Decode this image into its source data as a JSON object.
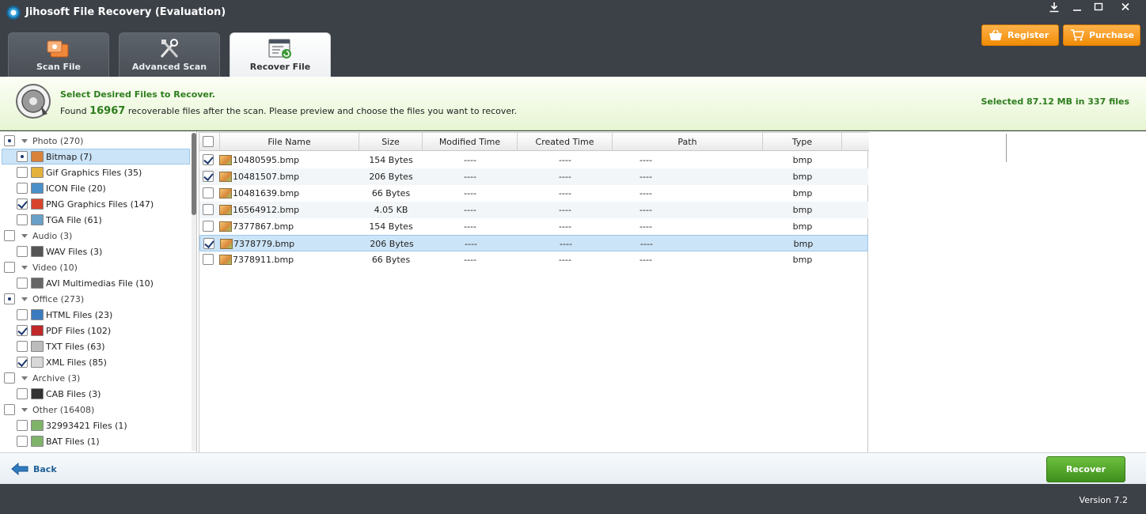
{
  "window": {
    "title": "Jihosoft File Recovery (Evaluation)",
    "controls": [
      "download",
      "minimize",
      "maximize",
      "close"
    ]
  },
  "tabs": [
    {
      "label": "Scan File",
      "icon": "scan-file-icon",
      "active": false
    },
    {
      "label": "Advanced Scan",
      "icon": "tools-icon",
      "active": false
    },
    {
      "label": "Recover File",
      "icon": "recover-file-icon",
      "active": true
    }
  ],
  "header_buttons": {
    "register": "Register",
    "purchase": "Purchase"
  },
  "banner": {
    "title": "Select Desired Files to Recover.",
    "found_prefix": "Found",
    "found_count": "16967",
    "found_suffix": "recoverable files after the scan. Please preview and choose the files you want to recover.",
    "selected": "Selected 87.12 MB in 337 files"
  },
  "tree": [
    {
      "label": "Photo (270)",
      "level": 0,
      "state": "partial"
    },
    {
      "label": "Bitmap (7)",
      "level": 1,
      "state": "partial",
      "selected": true,
      "icon_color": "#d9823a"
    },
    {
      "label": "Gif Graphics Files (35)",
      "level": 1,
      "state": "unchecked",
      "icon_color": "#e3b23c"
    },
    {
      "label": "ICON File (20)",
      "level": 1,
      "state": "unchecked",
      "icon_color": "#4a90c8"
    },
    {
      "label": "PNG Graphics Files (147)",
      "level": 1,
      "state": "checked",
      "icon_color": "#d8442b"
    },
    {
      "label": "TGA File (61)",
      "level": 1,
      "state": "unchecked",
      "icon_color": "#6aa0c8"
    },
    {
      "label": "Audio (3)",
      "level": 0,
      "state": "unchecked"
    },
    {
      "label": "WAV Files (3)",
      "level": 1,
      "state": "unchecked",
      "icon_color": "#555555"
    },
    {
      "label": "Video (10)",
      "level": 0,
      "state": "unchecked"
    },
    {
      "label": "AVI Multimedias File (10)",
      "level": 1,
      "state": "unchecked",
      "icon_color": "#666666"
    },
    {
      "label": "Office (273)",
      "level": 0,
      "state": "partial"
    },
    {
      "label": "HTML Files (23)",
      "level": 1,
      "state": "unchecked",
      "icon_color": "#3a7bbf"
    },
    {
      "label": "PDF Files (102)",
      "level": 1,
      "state": "checked",
      "icon_color": "#c0282a"
    },
    {
      "label": "TXT Files (63)",
      "level": 1,
      "state": "unchecked",
      "icon_color": "#bcbcbc"
    },
    {
      "label": "XML Files (85)",
      "level": 1,
      "state": "checked",
      "icon_color": "#d8d8d8"
    },
    {
      "label": "Archive (3)",
      "level": 0,
      "state": "unchecked"
    },
    {
      "label": "CAB Files (3)",
      "level": 1,
      "state": "unchecked",
      "icon_color": "#333333"
    },
    {
      "label": "Other (16408)",
      "level": 0,
      "state": "unchecked"
    },
    {
      "label": "32993421 Files (1)",
      "level": 1,
      "state": "unchecked",
      "icon_color": "#7fb36a"
    },
    {
      "label": "BAT Files (1)",
      "level": 1,
      "state": "unchecked",
      "icon_color": "#7fb36a"
    }
  ],
  "table": {
    "columns": [
      "File Name",
      "Size",
      "Modified Time",
      "Created Time",
      "Path",
      "Type"
    ],
    "rows": [
      {
        "name": "10480595.bmp",
        "size": "154 Bytes",
        "modified": "----",
        "created": "----",
        "path": "----",
        "type": "bmp",
        "checked": true,
        "selected": false
      },
      {
        "name": "10481507.bmp",
        "size": "206 Bytes",
        "modified": "----",
        "created": "----",
        "path": "----",
        "type": "bmp",
        "checked": true,
        "selected": false
      },
      {
        "name": "10481639.bmp",
        "size": "66 Bytes",
        "modified": "----",
        "created": "----",
        "path": "----",
        "type": "bmp",
        "checked": false,
        "selected": false
      },
      {
        "name": "16564912.bmp",
        "size": "4.05 KB",
        "modified": "----",
        "created": "----",
        "path": "----",
        "type": "bmp",
        "checked": false,
        "selected": false
      },
      {
        "name": "7377867.bmp",
        "size": "154 Bytes",
        "modified": "----",
        "created": "----",
        "path": "----",
        "type": "bmp",
        "checked": false,
        "selected": false
      },
      {
        "name": "7378779.bmp",
        "size": "206 Bytes",
        "modified": "----",
        "created": "----",
        "path": "----",
        "type": "bmp",
        "checked": true,
        "selected": true
      },
      {
        "name": "7378911.bmp",
        "size": "66 Bytes",
        "modified": "----",
        "created": "----",
        "path": "----",
        "type": "bmp",
        "checked": false,
        "selected": false
      }
    ]
  },
  "footer": {
    "back": "Back",
    "recover": "Recover",
    "version": "Version 7.2"
  },
  "colors": {
    "accent_green": "#2e7d1e",
    "orange": "#f08c06",
    "dark_bg": "#3c4047",
    "selection": "#cce4f7"
  }
}
